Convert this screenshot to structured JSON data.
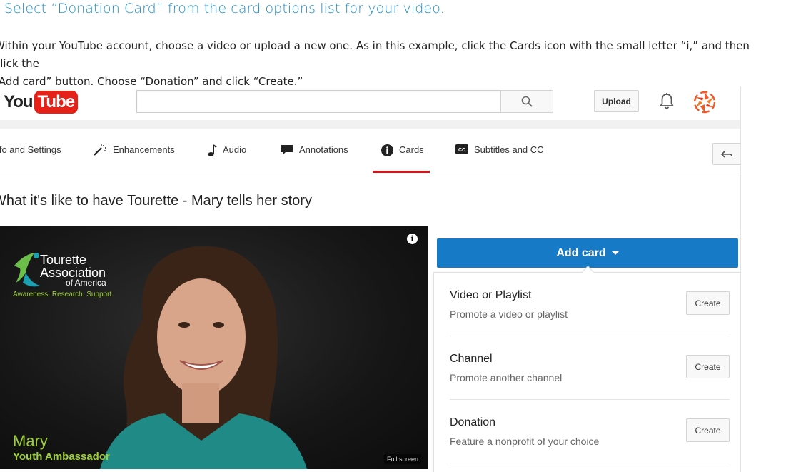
{
  "article": {
    "step_heading": "Select “Donation Card” from the card options list for your video.",
    "instructions_line1": "Within your YouTube account, choose a video or upload a new one. As in this example, click the Cards icon with the small letter “i,” and then click the",
    "instructions_line2": "“Add card” button. Choose “Donation” and click “Create.”"
  },
  "youtube": {
    "logo_you": "You",
    "logo_tube": "Tube",
    "search": {
      "placeholder": ""
    },
    "upload_label": "Upload",
    "icons": {
      "search": "search-icon",
      "bell": "bell-icon",
      "avatar": "avatar",
      "back": "back-arrow-icon"
    },
    "tabs": [
      {
        "label": "Info and Settings",
        "icon": ""
      },
      {
        "label": "Enhancements",
        "icon": "magic-wand-icon"
      },
      {
        "label": "Audio",
        "icon": "music-note-icon"
      },
      {
        "label": "Annotations",
        "icon": "speech-bubble-icon"
      },
      {
        "label": "Cards",
        "icon": "info-circle-icon",
        "active": true
      },
      {
        "label": "Subtitles and CC",
        "icon": "cc-icon"
      }
    ],
    "video_title": "What it's like to have Tourette - Mary tells her story",
    "video": {
      "org_line1": "Tourette",
      "org_line2": "Association",
      "org_line3": "of America",
      "org_tagline": "Awareness. Research. Support.",
      "speaker_name": "Mary",
      "speaker_role": "Youth Ambassador",
      "fullscreen_label": "Full screen"
    },
    "add_card_label": "Add card",
    "card_options": [
      {
        "title": "Video or Playlist",
        "desc": "Promote a video or playlist",
        "button": "Create"
      },
      {
        "title": "Channel",
        "desc": "Promote another channel",
        "button": "Create"
      },
      {
        "title": "Donation",
        "desc": "Feature a nonprofit of your choice",
        "button": "Create"
      }
    ],
    "colors": {
      "accent_blue": "#167ac6",
      "active_tab_red": "#cc181e",
      "brand_red": "#e62117",
      "org_green": "#9ecf3a",
      "heading_blue": "#1e8fc9"
    }
  }
}
